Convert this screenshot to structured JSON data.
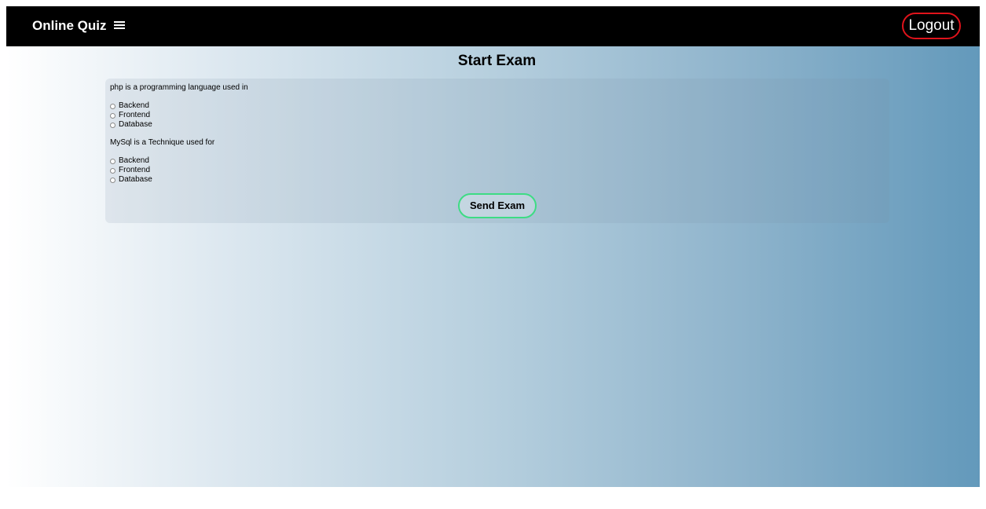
{
  "navbar": {
    "brand": "Online Quiz",
    "menu_icon": "hamburger-menu-icon",
    "logout_label": "Logout"
  },
  "main": {
    "title": "Start Exam",
    "questions": [
      {
        "text": "php is a programming language used in",
        "options": [
          "Backend",
          "Frontend",
          "Database"
        ]
      },
      {
        "text": "MySql is a Technique used for",
        "options": [
          "Backend",
          "Frontend",
          "Database"
        ]
      }
    ],
    "send_label": "Send Exam"
  },
  "colors": {
    "navbar_bg": "#000000",
    "logout_border": "#e0131b",
    "send_border": "#3ddc84",
    "gradient_end": "#6399bb"
  }
}
